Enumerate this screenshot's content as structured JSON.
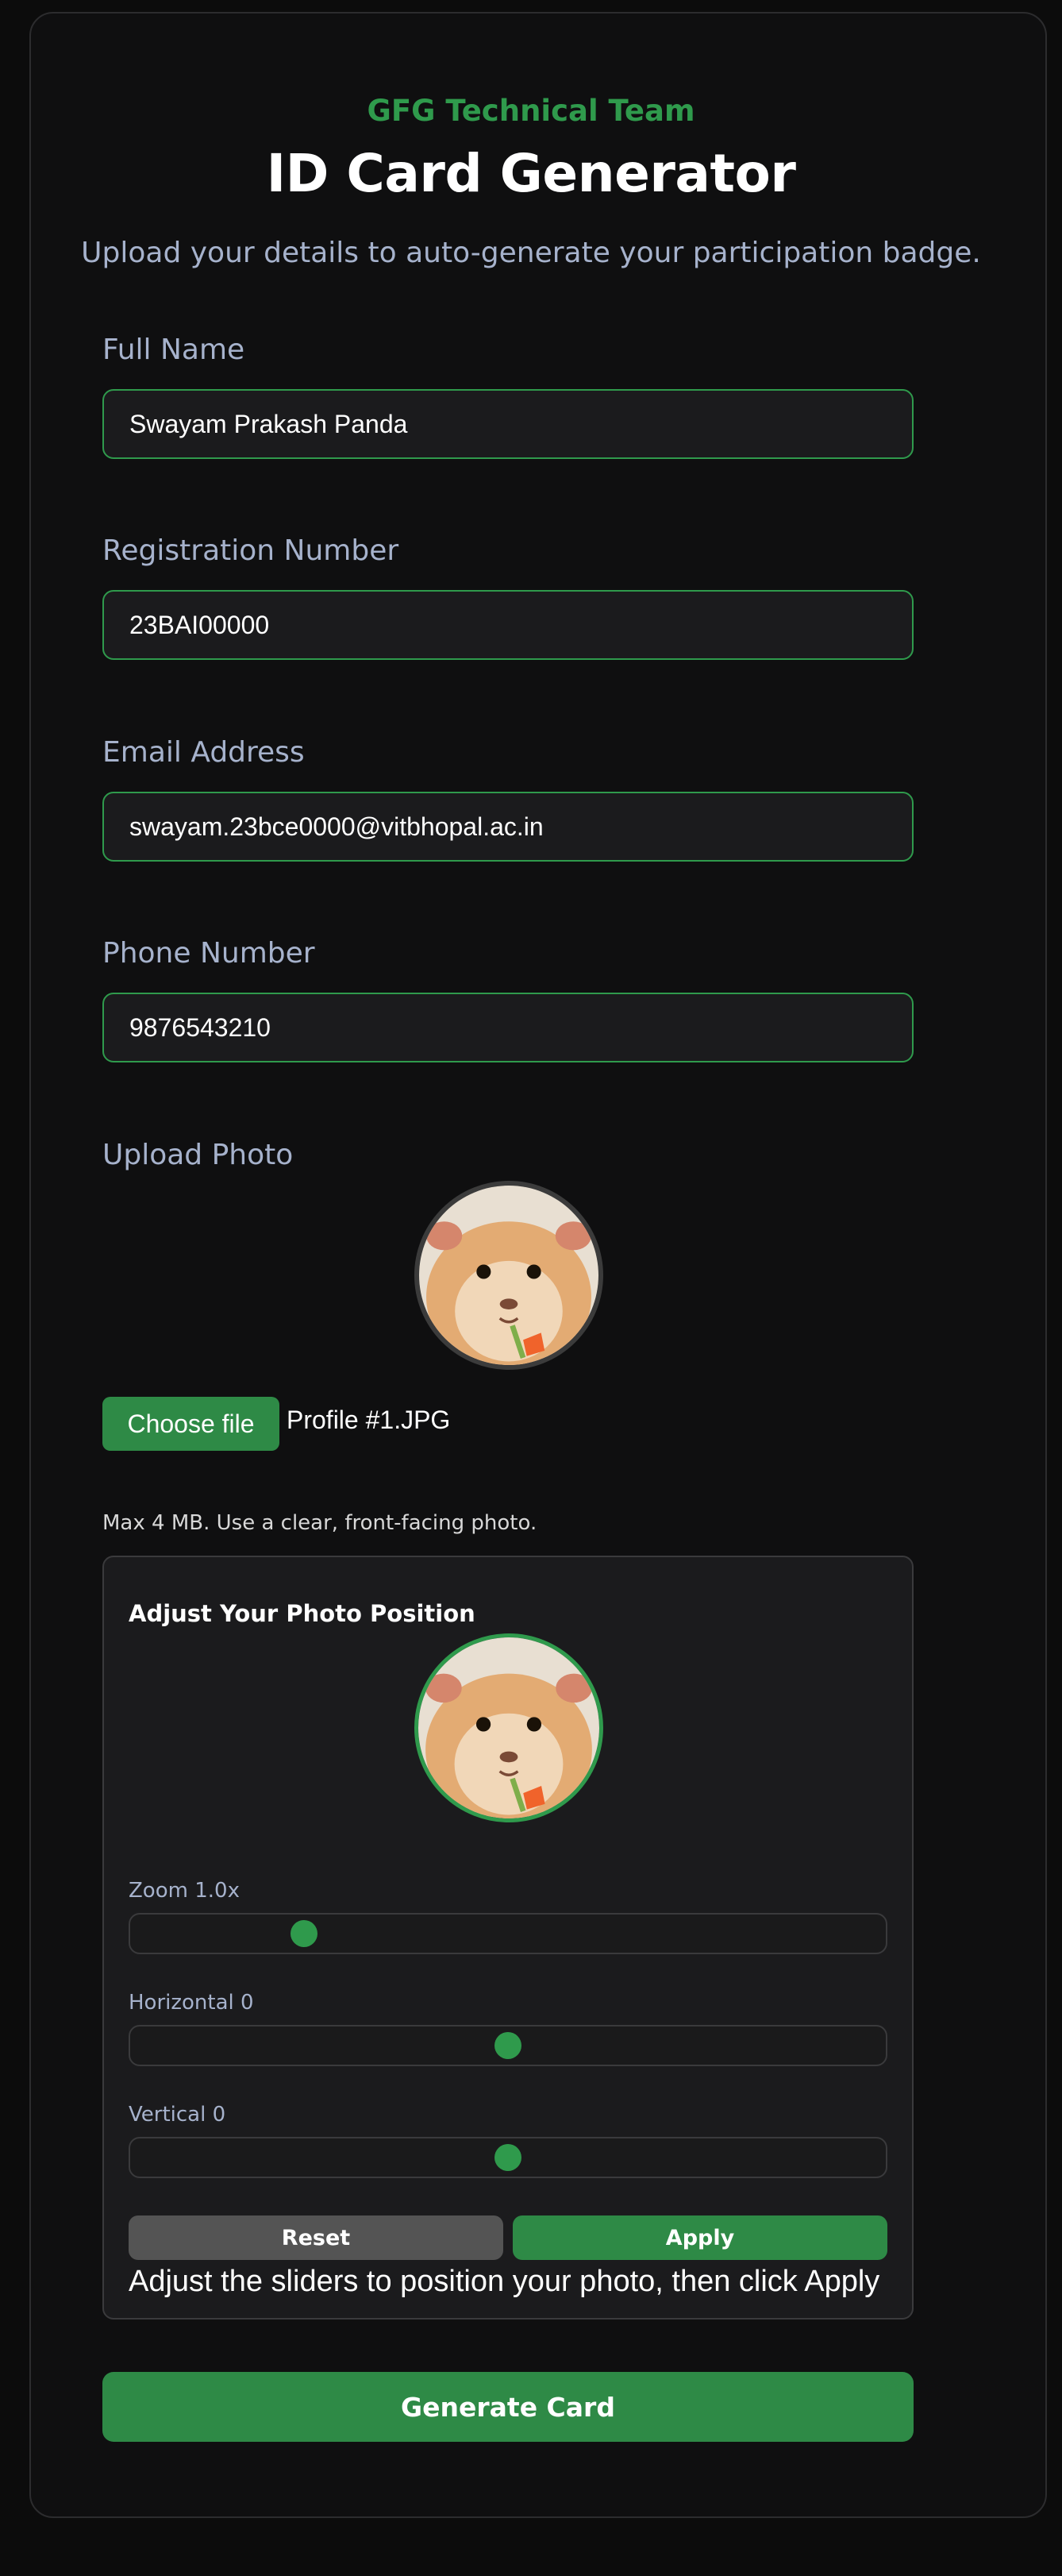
{
  "header": {
    "team": "GFG Technical Team",
    "title": "ID Card Generator",
    "subtitle": "Upload your details to auto-generate your participation badge."
  },
  "form": {
    "full_name": {
      "label": "Full Name",
      "value": "Swayam Prakash Panda"
    },
    "registration": {
      "label": "Registration Number",
      "value": "23BAI00000"
    },
    "email": {
      "label": "Email Address",
      "value": "swayam.23bce0000@vitbhopal.ac.in"
    },
    "phone": {
      "label": "Phone Number",
      "value": "9876543210"
    }
  },
  "photo": {
    "label": "Upload Photo",
    "choose_label": "Choose file",
    "file_name": "Profile #1.JPG",
    "hint": "Max 4 MB. Use a clear, front-facing photo."
  },
  "adjust": {
    "title": "Adjust Your Photo Position",
    "zoom": {
      "label": "Zoom 1.0x",
      "fraction": 0.23
    },
    "horizontal": {
      "label": "Horizontal 0",
      "fraction": 0.5
    },
    "vertical": {
      "label": "Vertical 0",
      "fraction": 0.5
    },
    "reset_label": "Reset",
    "apply_label": "Apply",
    "status": "Adjust the sliders to position your photo, then click Apply"
  },
  "generate_label": "Generate Card",
  "colors": {
    "accent": "#2f9a4c",
    "button": "#2e8a46",
    "label": "#a6b2cc",
    "background": "#0c0c0c"
  }
}
